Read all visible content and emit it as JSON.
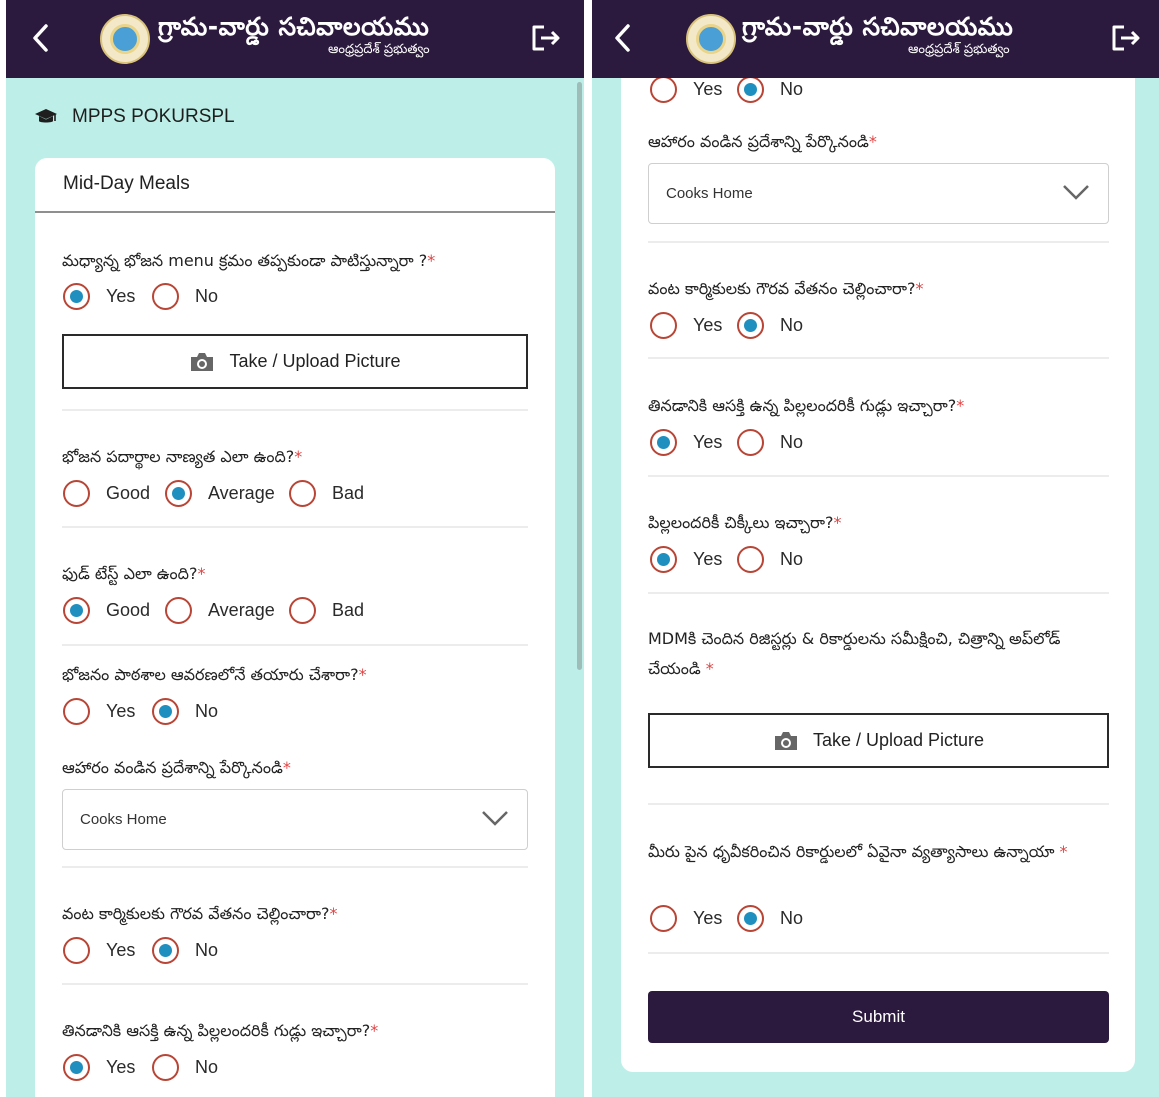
{
  "header": {
    "title": "గ్రామ-వార్డు సచివాలయము",
    "subtitle": "ఆంధ్రప్రదేశ్ ప్రభుత్వం"
  },
  "school": {
    "name": "MPPS POKURSPL"
  },
  "form": {
    "section_title": "Mid-Day Meals",
    "upload_label": "Take / Upload Picture",
    "submit_label": "Submit",
    "req_mark": "*",
    "questions": {
      "menu": {
        "label": "మధ్యాన్న భోజన menu క్రమం తప్పకుండా పాటిస్తున్నారా ?",
        "options": [
          "Yes",
          "No"
        ],
        "selected": "Yes"
      },
      "quality": {
        "label": "భోజన పదార్థాల నాణ్యత ఎలా ఉంది?",
        "options": [
          "Good",
          "Average",
          "Bad"
        ],
        "selected": "Average"
      },
      "taste": {
        "label": "ఫుడ్ టేస్ట్ ఎలా ఉంది?",
        "options": [
          "Good",
          "Average",
          "Bad"
        ],
        "selected": "Good"
      },
      "prepared": {
        "label": "భోజనం పాఠశాల ఆవరణలోనే తయారు చేశారా?",
        "options": [
          "Yes",
          "No"
        ],
        "selected": "No"
      },
      "place": {
        "label": "ఆహారం వండిన ప్రదేశాన్ని పేర్కొనండి",
        "value": "Cooks Home"
      },
      "honorarium": {
        "label": "వంట కార్మికులకు గౌరవ వేతనం చెల్లించారా?",
        "options": [
          "Yes",
          "No"
        ],
        "selected": "No"
      },
      "eggs": {
        "label": "తినడానికి ఆసక్తి ఉన్న పిల్లలందరికీ గుడ్లు ఇచ్చారా?",
        "options": [
          "Yes",
          "No"
        ],
        "selected": "Yes"
      },
      "chikki": {
        "label": "పిల్లలందరికీ చిక్కీలు ఇచ్చారా?",
        "options": [
          "Yes",
          "No"
        ],
        "selected": "Yes"
      },
      "registers": {
        "label": "MDMకి చెందిన రిజిస్టర్లు & రికార్డులను సమీక్షించి, చిత్రాన్ని అప్‌లోడ్ చేయండి"
      },
      "differences": {
        "label": "మీరు పైన ధృవీకరించిన రికార్డులలో ఏవైనా వ్యత్యాసాలు ఉన్నాయా",
        "options": [
          "Yes",
          "No"
        ],
        "selected": "No"
      }
    }
  }
}
